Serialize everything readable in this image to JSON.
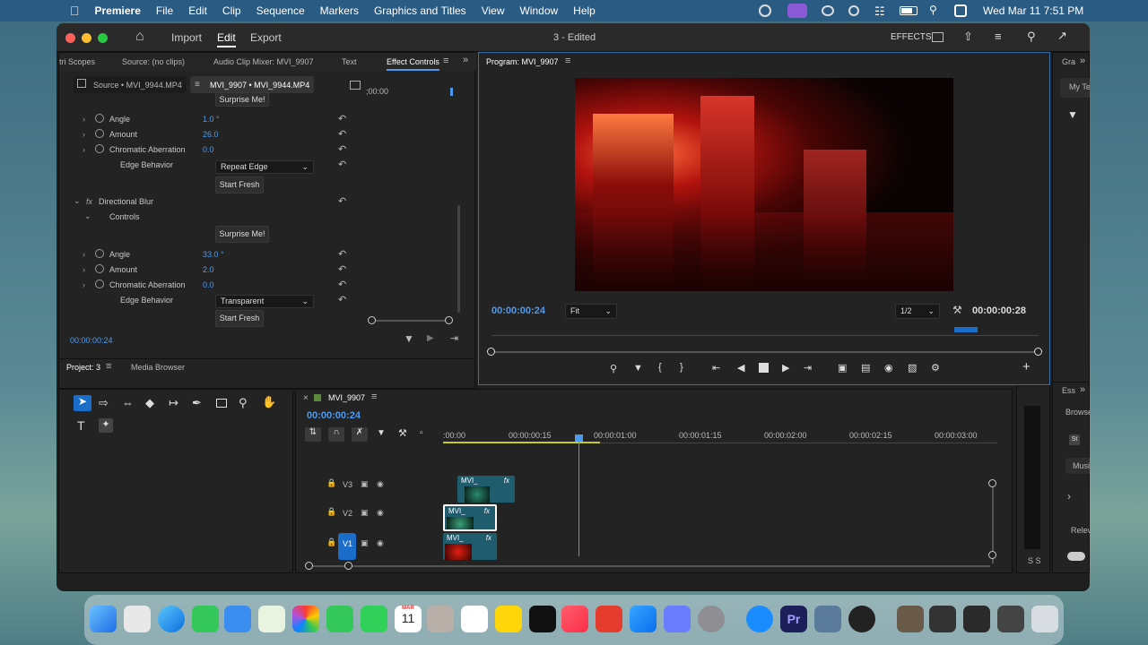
{
  "menubar": {
    "app": "Premiere",
    "items": [
      "File",
      "Edit",
      "Clip",
      "Sequence",
      "Markers",
      "Graphics and Titles",
      "View",
      "Window",
      "Help"
    ],
    "clock": "Wed Mar 11  7:51 PM"
  },
  "window": {
    "title": "3 - Edited",
    "nav": {
      "import": "Import",
      "edit": "Edit",
      "export": "Export"
    },
    "effects": "EFFECTS"
  },
  "effect_panel": {
    "tabs": [
      "tri Scopes",
      "Source: (no clips)",
      "Audio Clip Mixer: MVI_9907",
      "Text",
      "Effect Controls"
    ],
    "source_tab": "Source • MVI_9944.MP4",
    "clip_tab": "MVI_9907 • MVI_9944.MP4",
    "timecode_top": ";00:00",
    "surprise1": "Surprise Me!",
    "params1": [
      {
        "label": "Angle",
        "value": "1.0 °"
      },
      {
        "label": "Amount",
        "value": "26.0"
      },
      {
        "label": "Chromatic Aberration",
        "value": "0.0"
      }
    ],
    "edge1": {
      "label": "Edge Behavior",
      "value": "Repeat Edge"
    },
    "start1": "Start Fresh",
    "effect2": "Directional Blur",
    "controls": "Controls",
    "surprise2": "Surprise Me!",
    "params2": [
      {
        "label": "Angle",
        "value": "33.0 °"
      },
      {
        "label": "Amount",
        "value": "2.0"
      },
      {
        "label": "Chromatic Aberration",
        "value": "0.0"
      }
    ],
    "edge2": {
      "label": "Edge Behavior",
      "value": "Transparent"
    },
    "start2": "Start Fresh",
    "timecode": "00:00:00:24"
  },
  "project": {
    "tab": "Project: 3",
    "media": "Media Browser"
  },
  "program": {
    "tab": "Program: MVI_9907",
    "timecode": "00:00:00:24",
    "fit": "Fit",
    "resolution": "1/2",
    "duration": "00:00:00:28"
  },
  "right_panels": {
    "graphics": "Gra",
    "my_templates": "My Te",
    "essential": "Ess",
    "browse": "Browse",
    "music": "Musi",
    "relevance": "Relev",
    "meter_s": "S S"
  },
  "timeline": {
    "sequence": "MVI_9907",
    "timecode": "00:00:00:24",
    "ruler": [
      ":00:00",
      "00:00:00:15",
      "00:00:01:00",
      "00:00:01:15",
      "00:00:02:00",
      "00:00:02:15",
      "00:00:03:00"
    ],
    "tracks": [
      {
        "name": "V3",
        "clip": "MVI_"
      },
      {
        "name": "V2",
        "clip": "MVI_"
      },
      {
        "name": "V1",
        "clip": "MVI_"
      }
    ],
    "fx": "fx"
  },
  "calendar": {
    "month": "MAR",
    "day": "11"
  },
  "colors": {
    "accent": "#4d9bf0",
    "clip": "#1f5c6e",
    "v1_active": "#1a6dc9"
  }
}
